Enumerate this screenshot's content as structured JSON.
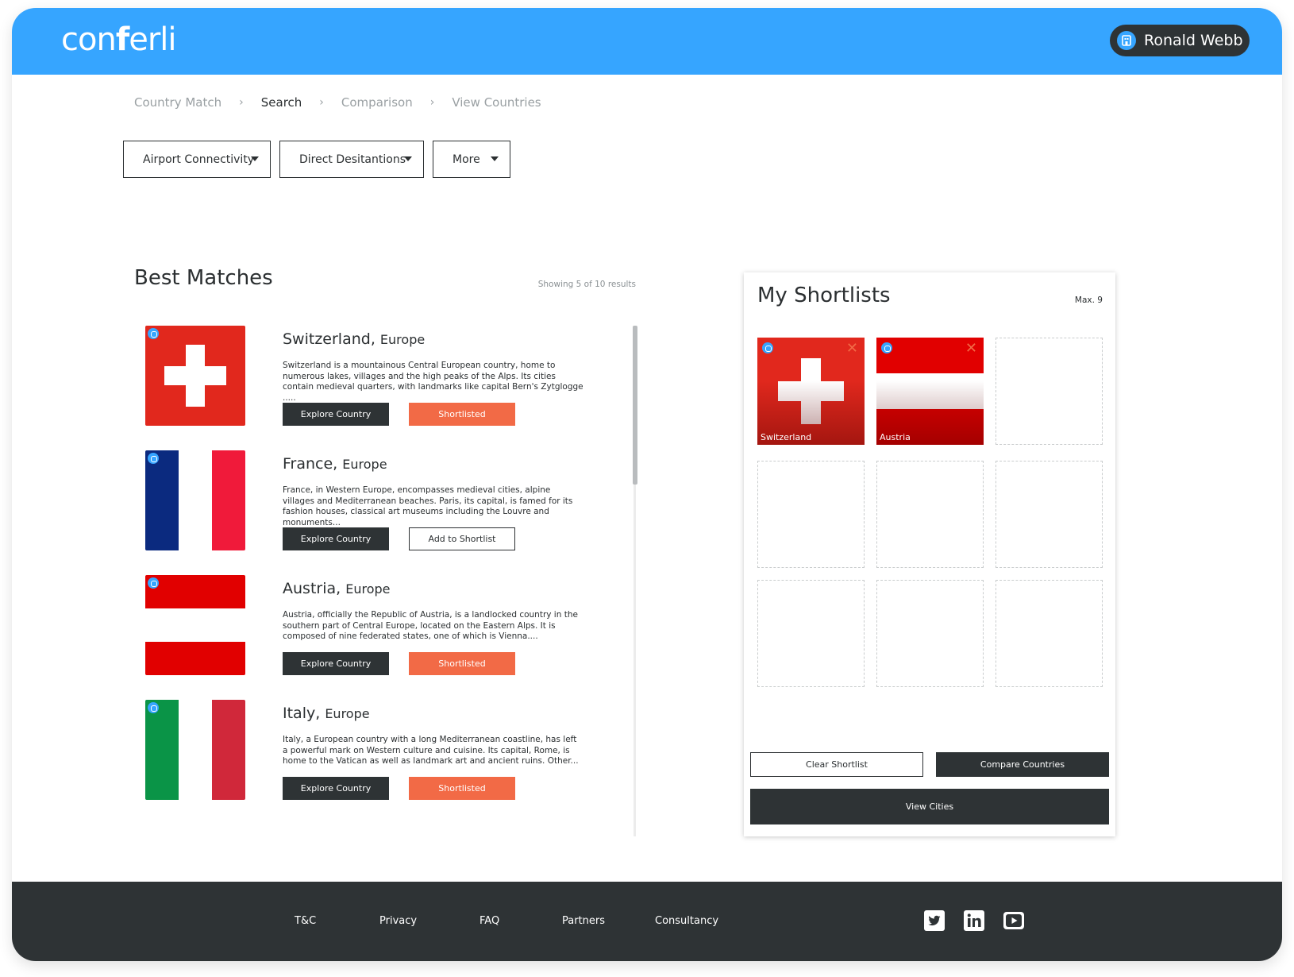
{
  "header": {
    "logo_pre": "con",
    "logo_bold": "f",
    "logo_post": "erli",
    "user_name": "Ronald Webb"
  },
  "breadcrumb": [
    "Country Match",
    "Search",
    "Comparison",
    "View Countries"
  ],
  "breadcrumb_active": "Search",
  "filters": [
    "Airport Connectivity",
    "Direct Desitantions",
    "More"
  ],
  "best_matches": {
    "title": "Best Matches",
    "count": "Showing 5 of 10 results",
    "explore_label": "Explore Country",
    "results": [
      {
        "country": "Switzerland,",
        "region": "Europe",
        "description": "Switzerland is a mountainous Central European country, home to numerous lakes, villages and the high peaks of the Alps. Its cities contain medieval quarters, with landmarks like capital Bern's Zytglogge .....",
        "action": "Shortlisted"
      },
      {
        "country": "France,",
        "region": "Europe",
        "description": "France, in Western Europe, encompasses medieval cities, alpine villages and Mediterranean beaches. Paris, its capital, is famed for its fashion houses, classical art museums including the Louvre and monuments...",
        "action": "Add to Shortlist"
      },
      {
        "country": "Austria,",
        "region": "Europe",
        "description": "Austria, officially the Republic of Austria, is a landlocked country in the southern part of Central Europe, located on the Eastern Alps. It is composed of nine federated states, one of which is Vienna....",
        "action": "Shortlisted"
      },
      {
        "country": "Italy,",
        "region": "Europe",
        "description": "Italy, a European country with a long Mediterranean coastline, has left a powerful mark on Western culture and cuisine. Its capital, Rome, is home to the Vatican as well as landmark art and ancient ruins. Other...",
        "action": "Shortlisted"
      }
    ]
  },
  "shortlist": {
    "title": "My Shortlists",
    "max": "Max. 9",
    "items": [
      "Switzerland",
      "Austria"
    ],
    "clear_label": "Clear Shortlist",
    "compare_label": "Compare Countries",
    "view_cities_label": "View Cities"
  },
  "footer": {
    "links": [
      "T&C",
      "Privacy",
      "FAQ",
      "Partners",
      "Consultancy"
    ],
    "social_icons": [
      "twitter-icon",
      "linkedin-icon",
      "youtube-icon"
    ]
  },
  "colors": {
    "header_blue": "#36a5ff",
    "dark": "#2e3335",
    "accent_orange": "#f26a46"
  }
}
